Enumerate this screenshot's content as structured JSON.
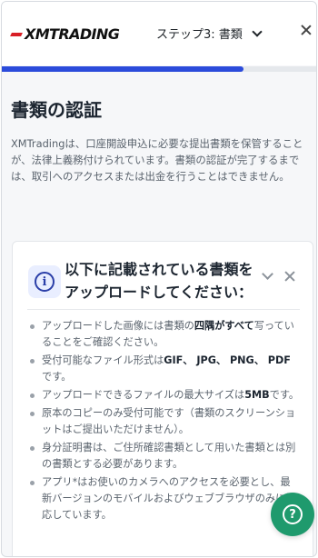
{
  "header": {
    "logo_text": "XMTRADING",
    "step_label": "ステップ3: 書類",
    "icons": {
      "logo_mark": "x-logo-icon",
      "step_toggle": "chevron-down-icon",
      "close": "close-icon"
    }
  },
  "progress": {
    "fraction": 0.77,
    "color": "#2b4bdb"
  },
  "page": {
    "title": "書類の認証",
    "intro": "XMTradingは、口座開設申込に必要な提出書類を保管することが、法律上義務付けられています。書類の認証が完了するまでは、取引へのアクセスまたは出金を行うことはできません。"
  },
  "notice": {
    "title": "以下に記載されている書類をアップロードしてください：",
    "icons": {
      "info": "info-icon",
      "collapse": "chevron-down-icon",
      "dismiss": "close-icon"
    },
    "rules": [
      {
        "pre": "アップロードした画像には書類の",
        "bold": "四隅がすべて",
        "post": "写っていることをご確認ください。"
      },
      {
        "pre": "受付可能なファイル形式は",
        "bold": "GIF、 JPG、 PNG、 PDF",
        "post": "です。"
      },
      {
        "pre": "アップロードできるファイルの最大サイズは",
        "bold": "5MB",
        "post": "です。"
      },
      {
        "pre": "原本のコピーのみ受付可能です（書類のスクリーンショットはご提出いただけません）。",
        "bold": "",
        "post": ""
      },
      {
        "pre": "身分証明書は、ご住所確認書類として用いた書類とは別の書類とする必要があります。",
        "bold": "",
        "post": ""
      },
      {
        "pre": "アプリ*はお使いのカメラへのアクセスを必要とし、最新バージョンのモバイルおよびウェブブラウザのみに対応しています。",
        "bold": "",
        "post": ""
      }
    ]
  },
  "help": {
    "icon": "help-icon",
    "color": "#1f9a6d"
  }
}
